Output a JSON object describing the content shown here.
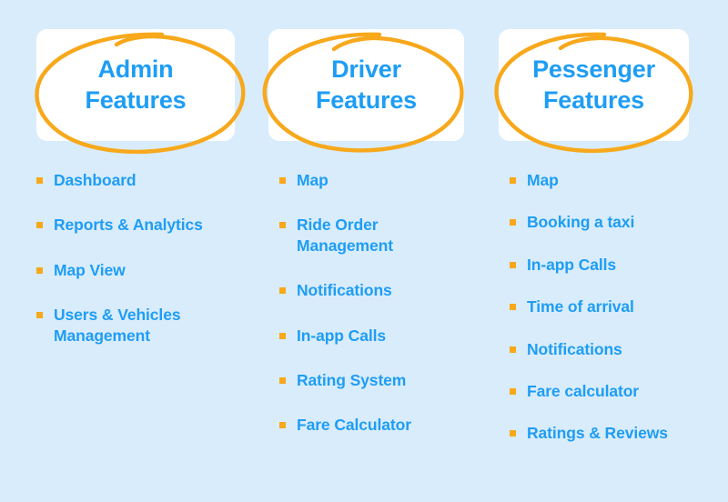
{
  "theme": {
    "background_color": "#d9ecfb",
    "card_color": "#ffffff",
    "text_blue": "#1e9df5",
    "accent_orange": "#f7a81b"
  },
  "columns": [
    {
      "id": "admin",
      "title": "Admin\nFeatures",
      "annotation_icon": "hand-drawn-ellipse",
      "items": [
        "Dashboard",
        "Reports & Analytics",
        "Map View",
        "Users & Vehicles Management"
      ]
    },
    {
      "id": "driver",
      "title": "Driver\nFeatures",
      "annotation_icon": "hand-drawn-ellipse",
      "items": [
        "Map",
        "Ride Order Management",
        "Notifications",
        "In-app Calls",
        "Rating System",
        "Fare Calculator"
      ]
    },
    {
      "id": "passenger",
      "title": "Pessenger\nFeatures",
      "annotation_icon": "hand-drawn-ellipse",
      "items": [
        "Map",
        "Booking a taxi",
        "In-app Calls",
        "Time of arrival",
        "Notifications",
        "Fare calculator",
        "Ratings & Reviews"
      ]
    }
  ]
}
